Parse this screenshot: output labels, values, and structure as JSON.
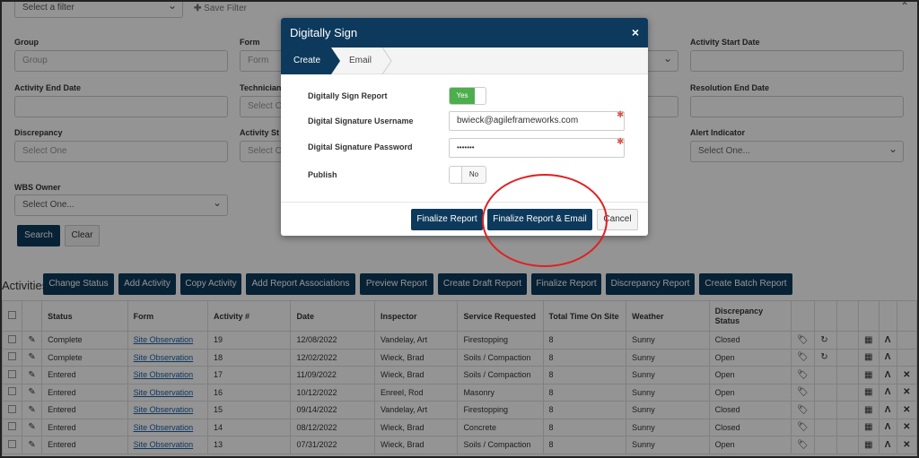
{
  "filter_bar": {
    "select_placeholder": "Select a filter",
    "save_filter": "Save Filter"
  },
  "filters": {
    "group_label": "Group",
    "group_placeholder": "Group",
    "form_label": "Form",
    "form_placeholder": "Form",
    "activity_start_label": "Activity Start Date",
    "activity_end_label": "Activity End Date",
    "technician_label": "Technician",
    "technician_placeholder": "Select O",
    "resolution_end_label": "Resolution End Date",
    "discrepancy_label": "Discrepancy",
    "discrepancy_placeholder": "Select One",
    "activity_status_label": "Activity St",
    "activity_status_placeholder": "Select O",
    "alert_label": "Alert Indicator",
    "alert_placeholder": "Select One...",
    "wbs_label": "WBS Owner",
    "wbs_placeholder": "Select One...",
    "search": "Search",
    "clear": "Clear"
  },
  "activities": {
    "title": "Activities",
    "buttons": [
      "Change Status",
      "Add Activity",
      "Copy Activity",
      "Add Report Associations",
      "Preview Report",
      "Create Draft Report",
      "Finalize Report",
      "Discrepancy Report",
      "Create Batch Report"
    ],
    "columns": [
      "Status",
      "Form",
      "Activity #",
      "Date",
      "Inspector",
      "Service Requested",
      "Total Time On Site",
      "Weather",
      "Discrepancy Status"
    ],
    "rows": [
      {
        "status": "Complete",
        "form": "Site Observation",
        "num": "19",
        "date": "12/08/2022",
        "inspector": "Vandelay, Art",
        "service": "Firestopping",
        "time": "8",
        "weather": "Sunny",
        "disc": "Closed",
        "refresh": true,
        "del": false
      },
      {
        "status": "Complete",
        "form": "Site Observation",
        "num": "18",
        "date": "12/02/2022",
        "inspector": "Wieck, Brad",
        "service": "Soils / Compaction",
        "time": "8",
        "weather": "Sunny",
        "disc": "Open",
        "refresh": true,
        "del": false
      },
      {
        "status": "Entered",
        "form": "Site Observation",
        "num": "17",
        "date": "11/09/2022",
        "inspector": "Wieck, Brad",
        "service": "Soils / Compaction",
        "time": "8",
        "weather": "Sunny",
        "disc": "Open",
        "refresh": false,
        "del": true
      },
      {
        "status": "Entered",
        "form": "Site Observation",
        "num": "16",
        "date": "10/12/2022",
        "inspector": "Enreel, Rod",
        "service": "Masonry",
        "time": "8",
        "weather": "Sunny",
        "disc": "Open",
        "refresh": false,
        "del": true
      },
      {
        "status": "Entered",
        "form": "Site Observation",
        "num": "15",
        "date": "09/14/2022",
        "inspector": "Vandelay, Art",
        "service": "Firestopping",
        "time": "8",
        "weather": "Sunny",
        "disc": "Closed",
        "refresh": false,
        "del": true
      },
      {
        "status": "Entered",
        "form": "Site Observation",
        "num": "14",
        "date": "08/12/2022",
        "inspector": "Wieck, Brad",
        "service": "Concrete",
        "time": "8",
        "weather": "Sunny",
        "disc": "Closed",
        "refresh": false,
        "del": true
      },
      {
        "status": "Entered",
        "form": "Site Observation",
        "num": "13",
        "date": "07/31/2022",
        "inspector": "Wieck, Brad",
        "service": "Soils / Compaction",
        "time": "8",
        "weather": "Sunny",
        "disc": "Open",
        "refresh": false,
        "del": true
      }
    ]
  },
  "modal": {
    "title": "Digitally Sign",
    "close": "×",
    "step_create": "Create",
    "step_email": "Email",
    "sign_label": "Digitally Sign Report",
    "sign_value": "Yes",
    "username_label": "Digital Signature Username",
    "username_value": "bwieck@agileframeworks.com",
    "password_label": "Digital Signature Password",
    "password_value": "•••••••",
    "publish_label": "Publish",
    "publish_value": "No",
    "finalize": "Finalize Report",
    "finalize_email": "Finalize Report & Email",
    "cancel": "Cancel"
  },
  "colors": {
    "navy": "#0d3a5c",
    "toggle_on": "#4cae4c",
    "annotation": "#e02020"
  }
}
